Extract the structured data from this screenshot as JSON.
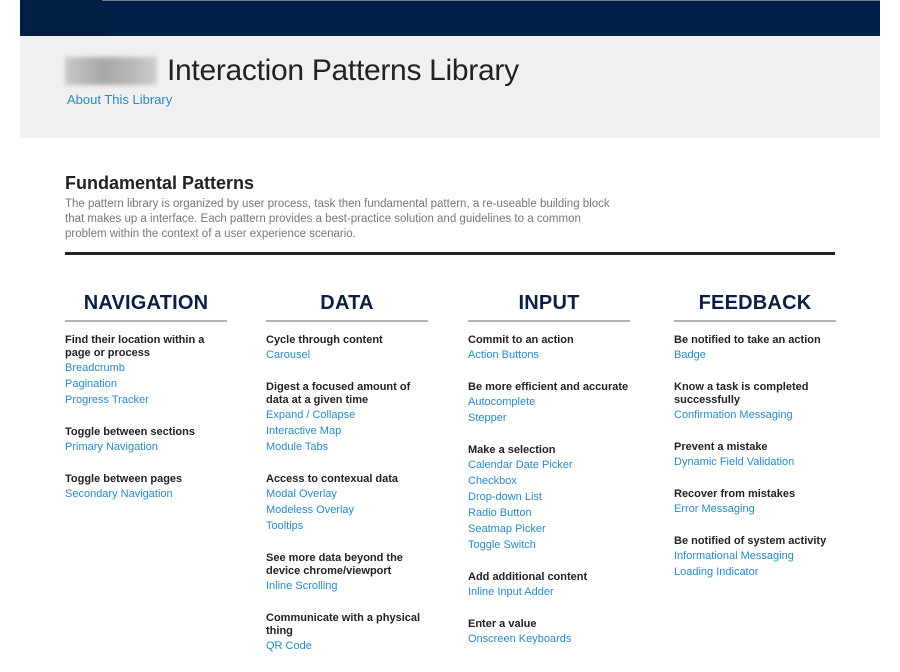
{
  "header": {
    "logo": "blurred-logo",
    "title": "Interaction Patterns Library",
    "about_link": "About This Library"
  },
  "intro": {
    "heading": "Fundamental Patterns",
    "description": "The pattern library is organized by user process, task then fundamental pattern, a re-useable building block that makes up a interface. Each pattern provides a best-practice solution and guidelines to a common problem within the context of a user experience scenario."
  },
  "colors": {
    "topbar": "#002147",
    "header_bg": "#f0f0f0",
    "link": "#2a8ac4",
    "category": "#0b1f45"
  },
  "columns": [
    {
      "title": "NAVIGATION",
      "groups": [
        {
          "task": "Find their location within a page or process",
          "links": [
            "Breadcrumb",
            "Pagination",
            "Progress Tracker"
          ]
        },
        {
          "task": "Toggle between sections",
          "links": [
            "Primary Navigation"
          ]
        },
        {
          "task": "Toggle between pages",
          "links": [
            "Secondary Navigation"
          ]
        }
      ]
    },
    {
      "title": "DATA",
      "groups": [
        {
          "task": "Cycle through content",
          "links": [
            "Carousel"
          ]
        },
        {
          "task": "Digest a focused amount of data at a given time",
          "links": [
            "Expand / Collapse",
            "Interactive Map",
            "Module Tabs"
          ]
        },
        {
          "task": "Access to contexual data",
          "links": [
            "Modal Overlay",
            "Modeless Overlay",
            "Tooltips"
          ]
        },
        {
          "task": "See more data beyond the device chrome/viewport",
          "links": [
            "Inline Scrolling"
          ]
        },
        {
          "task": "Communicate with a physical thing",
          "links": [
            "QR Code"
          ]
        }
      ]
    },
    {
      "title": "INPUT",
      "groups": [
        {
          "task": "Commit to an action",
          "links": [
            "Action Buttons"
          ]
        },
        {
          "task": "Be more efficient and accurate",
          "links": [
            "Autocomplete",
            "Stepper"
          ]
        },
        {
          "task": "Make a selection",
          "links": [
            "Calendar Date Picker",
            "Checkbox",
            "Drop-down List",
            "Radio Button",
            "Seatmap Picker",
            "Toggle Switch"
          ]
        },
        {
          "task": "Add additional content",
          "links": [
            "Inline Input Adder"
          ]
        },
        {
          "task": "Enter a value",
          "links": [
            "Onscreen Keyboards"
          ]
        }
      ]
    },
    {
      "title": "FEEDBACK",
      "groups": [
        {
          "task": "Be notified to take an action",
          "links": [
            "Badge"
          ]
        },
        {
          "task": "Know a task is completed successfully",
          "links": [
            "Confirmation Messaging"
          ]
        },
        {
          "task": "Prevent a mistake",
          "links": [
            "Dynamic Field Validation"
          ]
        },
        {
          "task": "Recover from mistakes",
          "links": [
            "Error Messaging"
          ]
        },
        {
          "task": "Be notified of system activity",
          "links": [
            "Informational Messaging",
            "Loading Indicator"
          ]
        }
      ]
    }
  ]
}
